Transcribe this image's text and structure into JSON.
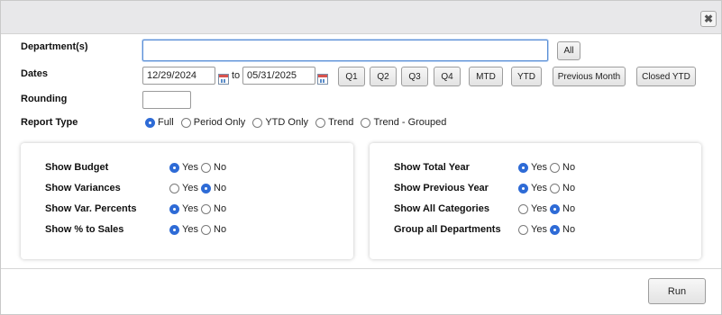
{
  "dialog": {
    "close_icon": "close-icon"
  },
  "form": {
    "department_label": "Department(s)",
    "department_value": "",
    "all_button": "All",
    "dates_label": "Dates",
    "date_from": "12/29/2024",
    "to_text": "to",
    "date_to": "05/31/2025",
    "calendar_icon": "calendar-icon",
    "date_buttons": [
      "Q1",
      "Q2",
      "Q3",
      "Q4",
      "MTD",
      "YTD",
      "Previous Month",
      "Closed YTD"
    ],
    "rounding_label": "Rounding",
    "rounding_value": "",
    "report_type_label": "Report Type",
    "report_types": [
      {
        "label": "Full",
        "checked": true
      },
      {
        "label": "Period Only",
        "checked": false
      },
      {
        "label": "YTD Only",
        "checked": false
      },
      {
        "label": "Trend",
        "checked": false
      },
      {
        "label": "Trend - Grouped",
        "checked": false
      }
    ]
  },
  "options_left": [
    {
      "label": "Show Budget",
      "value": "Yes"
    },
    {
      "label": "Show Variances",
      "value": "No"
    },
    {
      "label": "Show Var. Percents",
      "value": "Yes"
    },
    {
      "label": "Show % to Sales",
      "value": "Yes"
    }
  ],
  "options_right": [
    {
      "label": "Show Total Year",
      "value": "Yes"
    },
    {
      "label": "Show Previous Year",
      "value": "Yes"
    },
    {
      "label": "Show All Categories",
      "value": "No"
    },
    {
      "label": "Group all Departments",
      "value": "No"
    }
  ],
  "yes_label": "Yes",
  "no_label": "No",
  "footer": {
    "run_button": "Run"
  },
  "colors": {
    "accent": "#2e6bd6",
    "titlebar": "#e8e8ea"
  }
}
